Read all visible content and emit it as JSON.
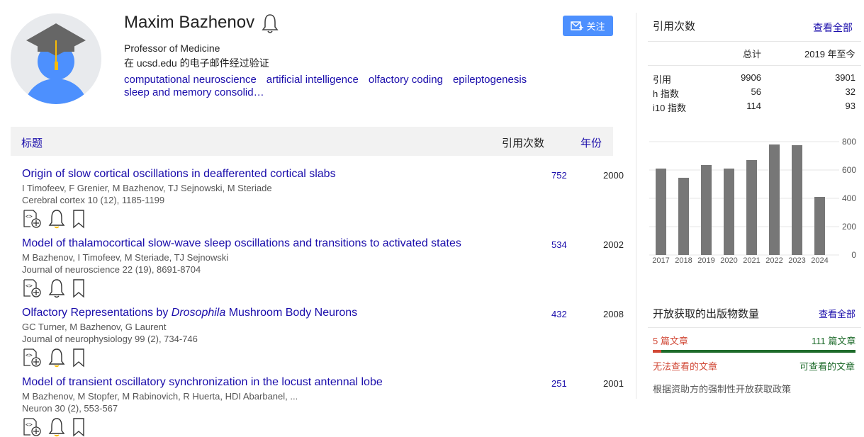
{
  "profile": {
    "name": "Maxim Bazhenov",
    "affiliation": "Professor of Medicine",
    "email_verified": "在 ucsd.edu 的电子邮件经过验证",
    "interests": [
      "computational neuroscience",
      "artificial intelligence",
      "olfactory coding",
      "epileptogenesis",
      "sleep and memory consolid…"
    ],
    "follow_label": "关注"
  },
  "table": {
    "headers": {
      "title": "标题",
      "cited_by": "引用次数",
      "year": "年份"
    },
    "rows": [
      {
        "title": "Origin of slow cortical oscillations in deafferented cortical slabs",
        "authors": "I Timofeev, F Grenier, M Bazhenov, TJ Sejnowski, M Steriade",
        "journal": "Cerebral cortex 10 (12), 1185-1199",
        "cites": "752",
        "year": "2000"
      },
      {
        "title": "Model of thalamocortical slow-wave sleep oscillations and transitions to activated states",
        "authors": "M Bazhenov, I Timofeev, M Steriade, TJ Sejnowski",
        "journal": "Journal of neuroscience 22 (19), 8691-8704",
        "cites": "534",
        "year": "2002"
      },
      {
        "title_pre": "Olfactory Representations by ",
        "title_em": "Drosophila",
        "title_post": " Mushroom Body Neurons",
        "authors": "GC Turner, M Bazhenov, G Laurent",
        "journal": "Journal of neurophysiology 99 (2), 734-746",
        "cites": "432",
        "year": "2008"
      },
      {
        "title": "Model of transient oscillatory synchronization in the locust antennal lobe",
        "authors": "M Bazhenov, M Stopfer, M Rabinovich, R Huerta, HDI Abarbanel, ...",
        "journal": "Neuron 30 (2), 553-567",
        "cites": "251",
        "year": "2001"
      }
    ]
  },
  "cited_by": {
    "heading": "引用次数",
    "view_all": "查看全部",
    "col_all": "总计",
    "col_since": "2019 年至今",
    "stats": [
      {
        "label": "引用",
        "all": "9906",
        "since": "3901"
      },
      {
        "label": "h 指数",
        "all": "56",
        "since": "32"
      },
      {
        "label": "i10 指数",
        "all": "114",
        "since": "93"
      }
    ]
  },
  "chart_data": {
    "type": "bar",
    "categories": [
      "2017",
      "2018",
      "2019",
      "2020",
      "2021",
      "2022",
      "2023",
      "2024"
    ],
    "values": [
      610,
      545,
      635,
      610,
      670,
      780,
      775,
      410
    ],
    "yticks": [
      "800",
      "600",
      "400",
      "200",
      "0"
    ],
    "ylim": [
      0,
      800
    ],
    "bar_color": "#777777"
  },
  "open_access": {
    "heading": "开放获取的出版物数量",
    "view_all": "查看全部",
    "not_available_count": "5 篇文章",
    "available_count": "111 篇文章",
    "not_available_label": "无法查看的文章",
    "available_label": "可查看的文章",
    "policy": "根据资助方的强制性开放获取政策",
    "fraction_not_available": 0.043
  }
}
